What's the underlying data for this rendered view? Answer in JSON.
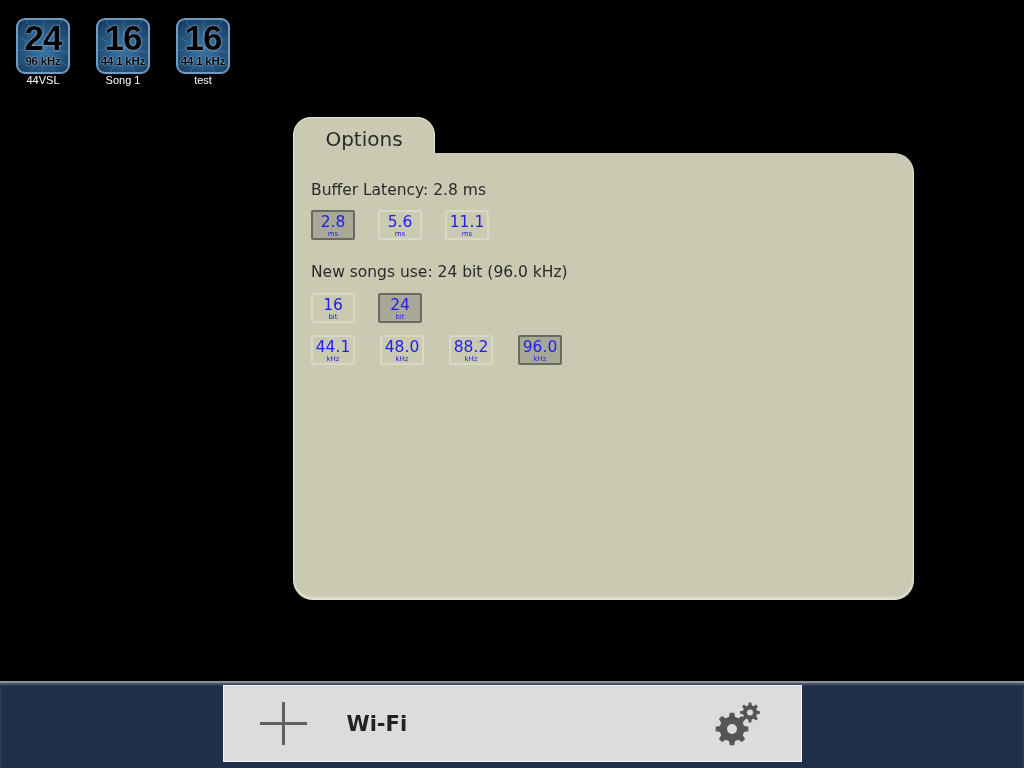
{
  "songs": [
    {
      "bits": "24",
      "rate": "96 kHz",
      "name": "44VSL"
    },
    {
      "bits": "16",
      "rate": "44.1 kHz",
      "name": "Song 1"
    },
    {
      "bits": "16",
      "rate": "44.1 kHz",
      "name": "test"
    }
  ],
  "options": {
    "tab": "Options",
    "latency": {
      "label": "Buffer Latency: 2.8 ms",
      "buttons": [
        {
          "value": "2.8",
          "unit": "ms",
          "selected": true
        },
        {
          "value": "5.6",
          "unit": "ms",
          "selected": false
        },
        {
          "value": "11.1",
          "unit": "ms",
          "selected": false
        }
      ]
    },
    "format": {
      "label": "New songs use: 24 bit (96.0 kHz)",
      "bit_depth": [
        {
          "value": "16",
          "unit": "bit",
          "selected": false
        },
        {
          "value": "24",
          "unit": "bit",
          "selected": true
        }
      ],
      "sample_rate": [
        {
          "value": "44.1",
          "unit": "kHz",
          "selected": false
        },
        {
          "value": "48.0",
          "unit": "kHz",
          "selected": false
        },
        {
          "value": "88.2",
          "unit": "kHz",
          "selected": false
        },
        {
          "value": "96.0",
          "unit": "kHz",
          "selected": true
        }
      ]
    }
  },
  "toolbar": {
    "wifi": "Wi-Fi"
  }
}
